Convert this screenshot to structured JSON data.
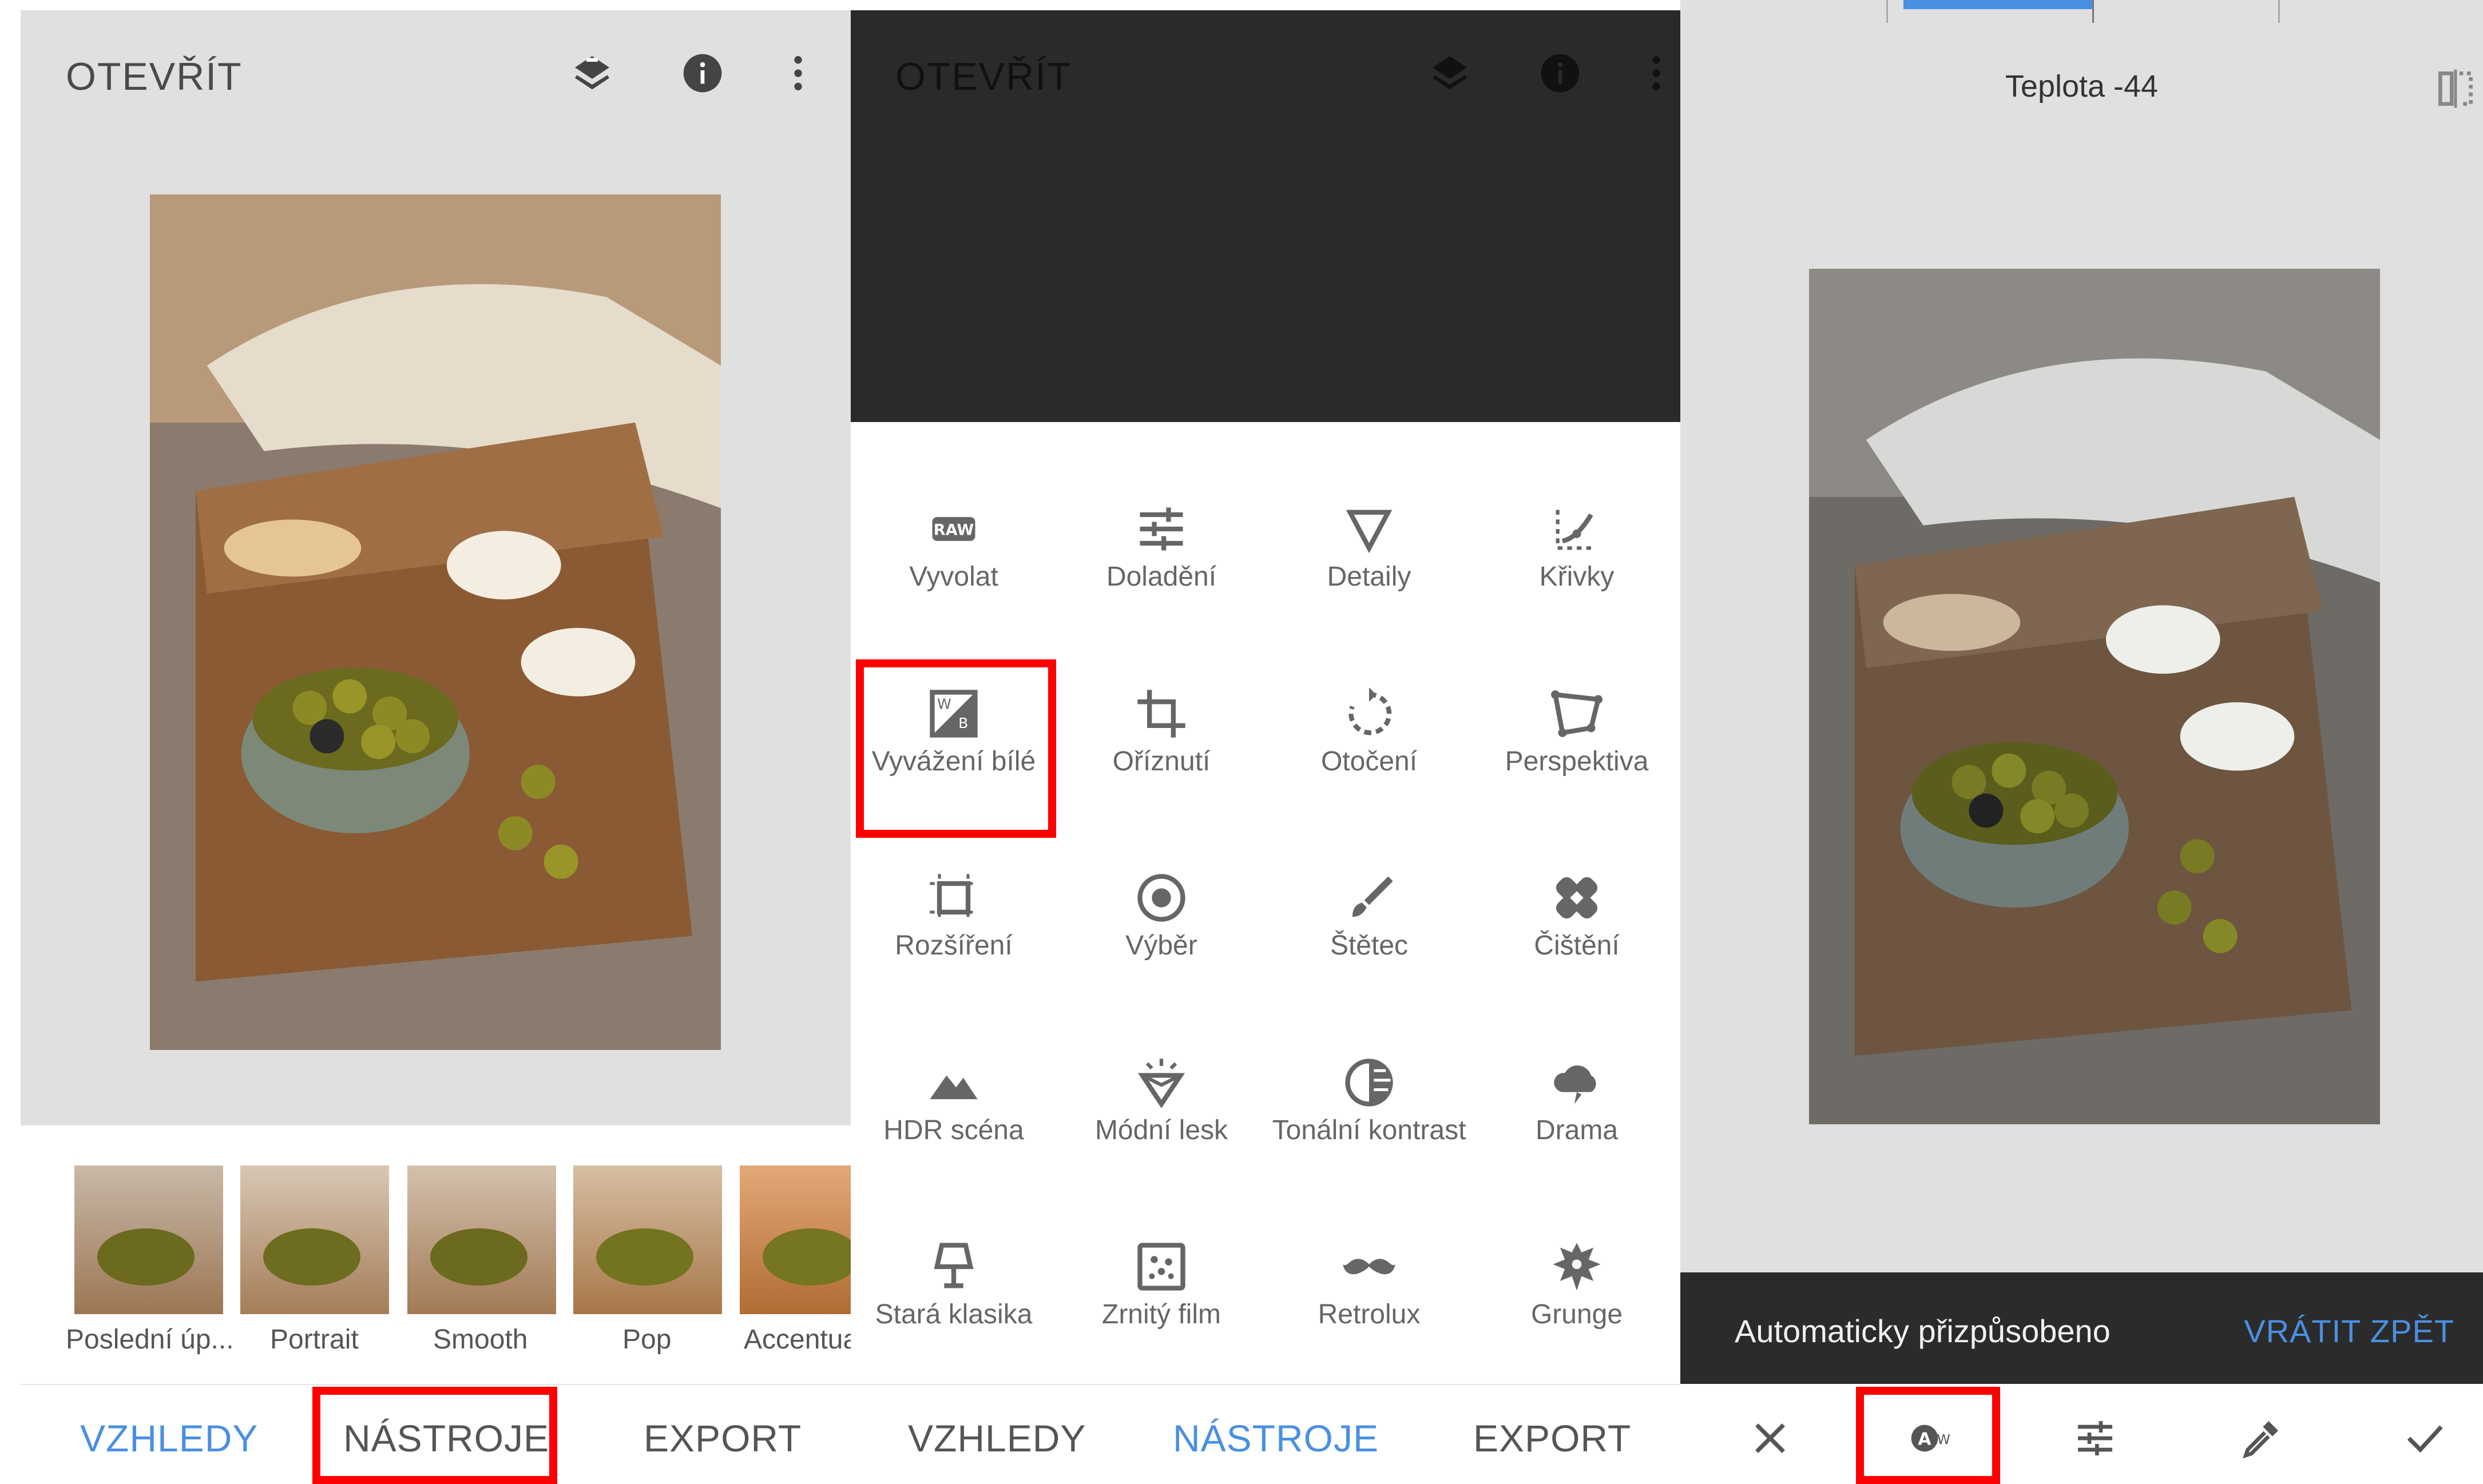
{
  "panel1": {
    "open_label": "OTEVŘÍT",
    "icons": {
      "layers": "layers-stack-icon",
      "info": "info-icon",
      "menu": "more-vert-icon"
    },
    "looks": [
      {
        "label": "Poslední úp..."
      },
      {
        "label": "Portrait"
      },
      {
        "label": "Smooth"
      },
      {
        "label": "Pop"
      },
      {
        "label": "Accentua"
      }
    ],
    "tabs": {
      "looks": "VZHLEDY",
      "tools": "NÁSTROJE",
      "export": "EXPORT"
    },
    "active_tab": "looks"
  },
  "panel2": {
    "open_label": "OTEVŘÍT",
    "tools": [
      {
        "label": "Vyvolat",
        "icon": "raw-icon"
      },
      {
        "label": "Doladění",
        "icon": "tune-sliders-icon"
      },
      {
        "label": "Detaily",
        "icon": "triangle-down-icon"
      },
      {
        "label": "Křivky",
        "icon": "curves-icon"
      },
      {
        "label": "Vyvážení bílé",
        "icon": "white-balance-icon"
      },
      {
        "label": "Oříznutí",
        "icon": "crop-icon"
      },
      {
        "label": "Otočení",
        "icon": "rotate-icon"
      },
      {
        "label": "Perspektiva",
        "icon": "perspective-icon"
      },
      {
        "label": "Rozšíření",
        "icon": "expand-icon"
      },
      {
        "label": "Výběr",
        "icon": "selective-icon"
      },
      {
        "label": "Štětec",
        "icon": "brush-icon"
      },
      {
        "label": "Čištění",
        "icon": "healing-icon"
      },
      {
        "label": "HDR scéna",
        "icon": "mountains-icon"
      },
      {
        "label": "Módní lesk",
        "icon": "glamour-icon"
      },
      {
        "label": "Tonální kontrast",
        "icon": "tonal-contrast-icon"
      },
      {
        "label": "Drama",
        "icon": "cloud-icon"
      },
      {
        "label": "Stará klasika",
        "icon": "lamp-icon"
      },
      {
        "label": "Zrnitý film",
        "icon": "grain-icon"
      },
      {
        "label": "Retrolux",
        "icon": "mustache-icon"
      },
      {
        "label": "Grunge",
        "icon": "grunge-icon"
      }
    ],
    "tabs": {
      "looks": "VZHLEDY",
      "tools": "NÁSTROJE",
      "export": "EXPORT"
    },
    "active_tab": "tools"
  },
  "panel3": {
    "title": "Teplota -44",
    "snackbar_text": "Automaticky přizpůsobeno",
    "snackbar_action": "VRÁTIT ZPĚT",
    "bottom_icons": [
      "close-icon",
      "auto-white-balance-icon",
      "tune-sliders-icon",
      "eyedropper-icon",
      "check-icon"
    ]
  },
  "colors": {
    "accent": "#4a90e2",
    "highlight": "#ff0000",
    "text": "#555555"
  }
}
